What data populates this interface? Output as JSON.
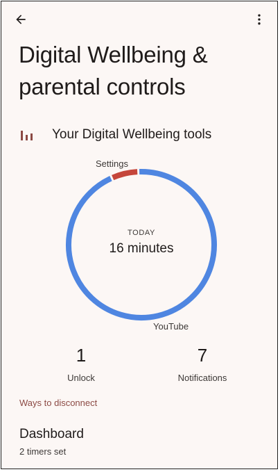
{
  "header": {
    "title": "Digital Wellbeing & parental controls"
  },
  "tools": {
    "label": "Your Digital Wellbeing tools",
    "icon": "bar-chart-icon"
  },
  "usage": {
    "period_label": "TODAY",
    "total": "16 minutes",
    "segments": [
      {
        "name": "Settings",
        "fraction": 0.06,
        "color": "#c5463b"
      },
      {
        "name": "YouTube",
        "fraction": 0.94,
        "color": "#4f86e1"
      }
    ]
  },
  "stats": {
    "unlocks": {
      "value": "1",
      "label": "Unlock"
    },
    "notifications": {
      "value": "7",
      "label": "Notifications"
    }
  },
  "section": {
    "title": "Ways to disconnect"
  },
  "dashboard": {
    "title": "Dashboard",
    "subtitle": "2 timers set"
  },
  "colors": {
    "background": "#fcf7f5",
    "accent": "#8c4a44"
  }
}
